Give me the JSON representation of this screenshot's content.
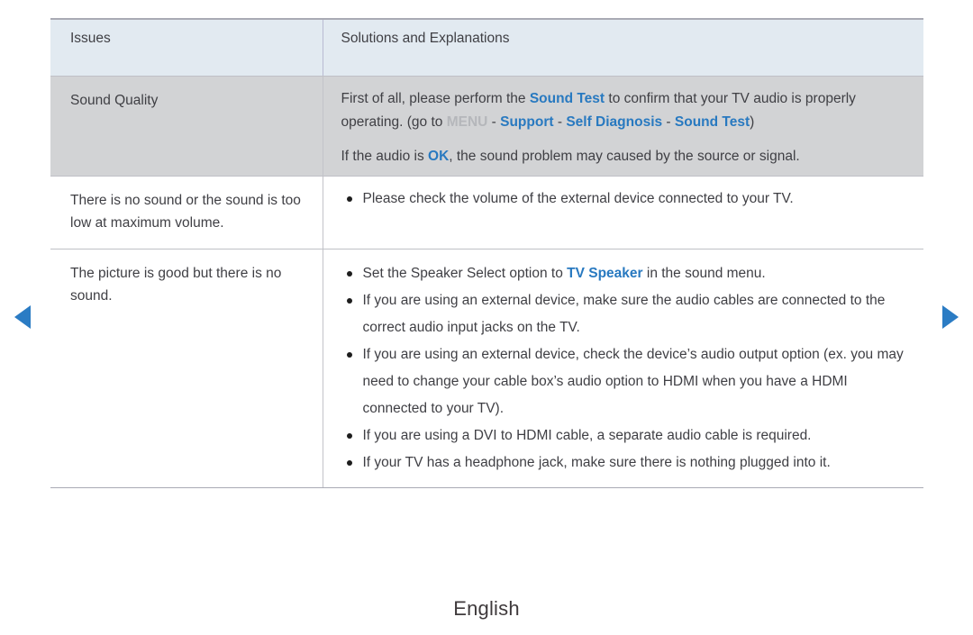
{
  "nav": {
    "prev_label": "previous page",
    "next_label": "next page"
  },
  "table": {
    "headers": {
      "issues": "Issues",
      "solutions": "Solutions and Explanations"
    },
    "rows": [
      {
        "issue": "Sound Quality",
        "paragraphs": [
          {
            "segments": [
              {
                "text": "First of all, please perform the ",
                "style": "normal"
              },
              {
                "text": "Sound Test",
                "style": "highlight"
              },
              {
                "text": " to confirm that your TV audio is properly operating. (go to ",
                "style": "normal"
              },
              {
                "text": "MENU",
                "style": "menu"
              },
              {
                "text": " - ",
                "style": "normal"
              },
              {
                "text": "Support",
                "style": "highlight"
              },
              {
                "text": " - ",
                "style": "normal"
              },
              {
                "text": "Self Diagnosis",
                "style": "highlight"
              },
              {
                "text": " - ",
                "style": "normal"
              },
              {
                "text": "Sound Test",
                "style": "highlight"
              },
              {
                "text": ")",
                "style": "normal"
              }
            ]
          },
          {
            "segments": [
              {
                "text": "If the audio is ",
                "style": "normal"
              },
              {
                "text": "OK",
                "style": "highlight"
              },
              {
                "text": ", the sound problem may caused by the source or signal.",
                "style": "normal"
              }
            ]
          }
        ]
      },
      {
        "issue": "There is no sound or the sound is too low at maximum volume.",
        "bullets": [
          {
            "segments": [
              {
                "text": "Please check the volume of the external device connected to your TV.",
                "style": "normal"
              }
            ]
          }
        ]
      },
      {
        "issue": "The picture is good but there is no sound.",
        "bullets": [
          {
            "segments": [
              {
                "text": "Set the Speaker Select option to ",
                "style": "normal"
              },
              {
                "text": "TV Speaker",
                "style": "highlight"
              },
              {
                "text": " in the sound menu.",
                "style": "normal"
              }
            ]
          },
          {
            "segments": [
              {
                "text": "If you are using an external device, make sure the audio cables are connected to the correct audio input jacks on the TV.",
                "style": "normal"
              }
            ]
          },
          {
            "segments": [
              {
                "text": "If you are using an external device, check the device’s audio output option (ex. you may need to change your cable box’s audio option to HDMI when you have a HDMI connected to your TV).",
                "style": "normal"
              }
            ]
          },
          {
            "segments": [
              {
                "text": "If you are using a DVI to HDMI cable, a separate audio cable is required.",
                "style": "normal"
              }
            ]
          },
          {
            "segments": [
              {
                "text": "If your TV has a headphone jack, make sure there is nothing plugged into it.",
                "style": "normal"
              }
            ]
          }
        ]
      }
    ]
  },
  "footer": {
    "language": "English"
  },
  "colors": {
    "highlight_blue": "#2879c0",
    "menu_gray": "#b5b7bb",
    "arrow_blue": "#2b7cc4",
    "header_bg": "#e2eaf1",
    "grey_row_bg": "#d2d3d5"
  }
}
